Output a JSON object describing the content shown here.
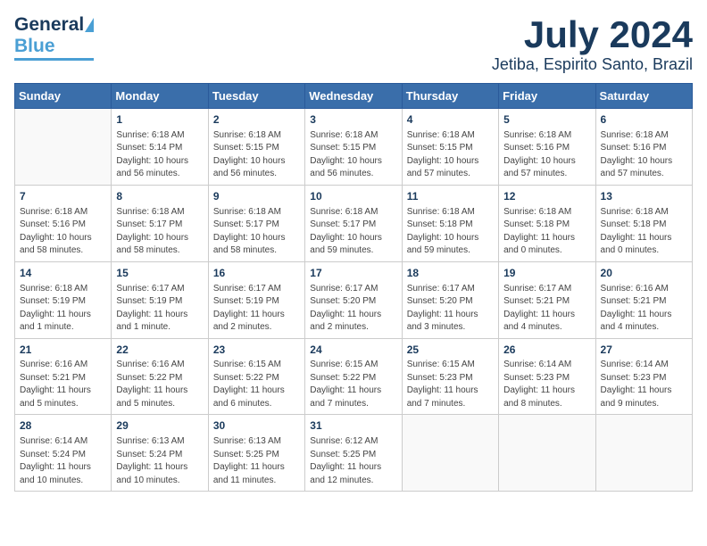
{
  "header": {
    "logo_general": "General",
    "logo_blue": "Blue",
    "title": "July 2024",
    "subtitle": "Jetiba, Espirito Santo, Brazil"
  },
  "calendar": {
    "days_of_week": [
      "Sunday",
      "Monday",
      "Tuesday",
      "Wednesday",
      "Thursday",
      "Friday",
      "Saturday"
    ],
    "weeks": [
      [
        {
          "day": "",
          "info": ""
        },
        {
          "day": "1",
          "info": "Sunrise: 6:18 AM\nSunset: 5:14 PM\nDaylight: 10 hours\nand 56 minutes."
        },
        {
          "day": "2",
          "info": "Sunrise: 6:18 AM\nSunset: 5:15 PM\nDaylight: 10 hours\nand 56 minutes."
        },
        {
          "day": "3",
          "info": "Sunrise: 6:18 AM\nSunset: 5:15 PM\nDaylight: 10 hours\nand 56 minutes."
        },
        {
          "day": "4",
          "info": "Sunrise: 6:18 AM\nSunset: 5:15 PM\nDaylight: 10 hours\nand 57 minutes."
        },
        {
          "day": "5",
          "info": "Sunrise: 6:18 AM\nSunset: 5:16 PM\nDaylight: 10 hours\nand 57 minutes."
        },
        {
          "day": "6",
          "info": "Sunrise: 6:18 AM\nSunset: 5:16 PM\nDaylight: 10 hours\nand 57 minutes."
        }
      ],
      [
        {
          "day": "7",
          "info": "Sunrise: 6:18 AM\nSunset: 5:16 PM\nDaylight: 10 hours\nand 58 minutes."
        },
        {
          "day": "8",
          "info": "Sunrise: 6:18 AM\nSunset: 5:17 PM\nDaylight: 10 hours\nand 58 minutes."
        },
        {
          "day": "9",
          "info": "Sunrise: 6:18 AM\nSunset: 5:17 PM\nDaylight: 10 hours\nand 58 minutes."
        },
        {
          "day": "10",
          "info": "Sunrise: 6:18 AM\nSunset: 5:17 PM\nDaylight: 10 hours\nand 59 minutes."
        },
        {
          "day": "11",
          "info": "Sunrise: 6:18 AM\nSunset: 5:18 PM\nDaylight: 10 hours\nand 59 minutes."
        },
        {
          "day": "12",
          "info": "Sunrise: 6:18 AM\nSunset: 5:18 PM\nDaylight: 11 hours\nand 0 minutes."
        },
        {
          "day": "13",
          "info": "Sunrise: 6:18 AM\nSunset: 5:18 PM\nDaylight: 11 hours\nand 0 minutes."
        }
      ],
      [
        {
          "day": "14",
          "info": "Sunrise: 6:18 AM\nSunset: 5:19 PM\nDaylight: 11 hours\nand 1 minute."
        },
        {
          "day": "15",
          "info": "Sunrise: 6:17 AM\nSunset: 5:19 PM\nDaylight: 11 hours\nand 1 minute."
        },
        {
          "day": "16",
          "info": "Sunrise: 6:17 AM\nSunset: 5:19 PM\nDaylight: 11 hours\nand 2 minutes."
        },
        {
          "day": "17",
          "info": "Sunrise: 6:17 AM\nSunset: 5:20 PM\nDaylight: 11 hours\nand 2 minutes."
        },
        {
          "day": "18",
          "info": "Sunrise: 6:17 AM\nSunset: 5:20 PM\nDaylight: 11 hours\nand 3 minutes."
        },
        {
          "day": "19",
          "info": "Sunrise: 6:17 AM\nSunset: 5:21 PM\nDaylight: 11 hours\nand 4 minutes."
        },
        {
          "day": "20",
          "info": "Sunrise: 6:16 AM\nSunset: 5:21 PM\nDaylight: 11 hours\nand 4 minutes."
        }
      ],
      [
        {
          "day": "21",
          "info": "Sunrise: 6:16 AM\nSunset: 5:21 PM\nDaylight: 11 hours\nand 5 minutes."
        },
        {
          "day": "22",
          "info": "Sunrise: 6:16 AM\nSunset: 5:22 PM\nDaylight: 11 hours\nand 5 minutes."
        },
        {
          "day": "23",
          "info": "Sunrise: 6:15 AM\nSunset: 5:22 PM\nDaylight: 11 hours\nand 6 minutes."
        },
        {
          "day": "24",
          "info": "Sunrise: 6:15 AM\nSunset: 5:22 PM\nDaylight: 11 hours\nand 7 minutes."
        },
        {
          "day": "25",
          "info": "Sunrise: 6:15 AM\nSunset: 5:23 PM\nDaylight: 11 hours\nand 7 minutes."
        },
        {
          "day": "26",
          "info": "Sunrise: 6:14 AM\nSunset: 5:23 PM\nDaylight: 11 hours\nand 8 minutes."
        },
        {
          "day": "27",
          "info": "Sunrise: 6:14 AM\nSunset: 5:23 PM\nDaylight: 11 hours\nand 9 minutes."
        }
      ],
      [
        {
          "day": "28",
          "info": "Sunrise: 6:14 AM\nSunset: 5:24 PM\nDaylight: 11 hours\nand 10 minutes."
        },
        {
          "day": "29",
          "info": "Sunrise: 6:13 AM\nSunset: 5:24 PM\nDaylight: 11 hours\nand 10 minutes."
        },
        {
          "day": "30",
          "info": "Sunrise: 6:13 AM\nSunset: 5:25 PM\nDaylight: 11 hours\nand 11 minutes."
        },
        {
          "day": "31",
          "info": "Sunrise: 6:12 AM\nSunset: 5:25 PM\nDaylight: 11 hours\nand 12 minutes."
        },
        {
          "day": "",
          "info": ""
        },
        {
          "day": "",
          "info": ""
        },
        {
          "day": "",
          "info": ""
        }
      ]
    ]
  }
}
